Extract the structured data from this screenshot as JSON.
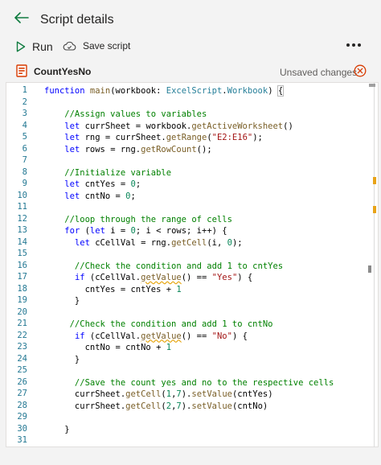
{
  "header": {
    "title": "Script details",
    "back_icon": "arrow-left-icon"
  },
  "toolbar": {
    "run_label": "Run",
    "save_label": "Save script",
    "more_icon": "more-horizontal-icon"
  },
  "file": {
    "name": "CountYesNo",
    "status": "Unsaved changes",
    "icon": "script-file-icon",
    "close_icon": "close-circle-icon"
  },
  "editor": {
    "line_numbers": [
      "1",
      "2",
      "3",
      "4",
      "5",
      "6",
      "7",
      "8",
      "9",
      "10",
      "11",
      "12",
      "13",
      "14",
      "15",
      "16",
      "17",
      "18",
      "19",
      "20",
      "21",
      "22",
      "23",
      "24",
      "25",
      "26",
      "27",
      "28",
      "29",
      "30",
      "31"
    ],
    "lines": [
      "function main(workbook: ExcelScript.Workbook) {",
      "",
      "    //Assign values to variables",
      "    let currSheet = workbook.getActiveWorksheet()",
      "    let rng = currSheet.getRange(\"E2:E16\");",
      "    let rows = rng.getRowCount();",
      "",
      "    //Initialize variable",
      "    let cntYes = 0;",
      "    let cntNo = 0;",
      "",
      "    //loop through the range of cells",
      "    for (let i = 0; i < rows; i++) {",
      "      let cCellVal = rng.getCell(i, 0);",
      "",
      "      //Check the condition and add 1 to cntYes",
      "      if (cCellVal.getValue() == \"Yes\") {",
      "        cntYes = cntYes + 1",
      "      }",
      "",
      "     //Check the condition and add 1 to cntNo",
      "      if (cCellVal.getValue() == \"No\") {",
      "        cntNo = cntNo + 1",
      "      }",
      "",
      "      //Save the count yes and no to the respective cells",
      "      currSheet.getCell(1,7).setValue(cntYes)",
      "      currSheet.getCell(2,7).setValue(cntNo)",
      "",
      "    }",
      ""
    ]
  },
  "colors": {
    "accent": "#0f7b3f",
    "close": "#d83b01",
    "keyword": "#0000ff",
    "comment": "#008000",
    "string": "#a31515",
    "number": "#098658",
    "line_number": "#237893"
  }
}
